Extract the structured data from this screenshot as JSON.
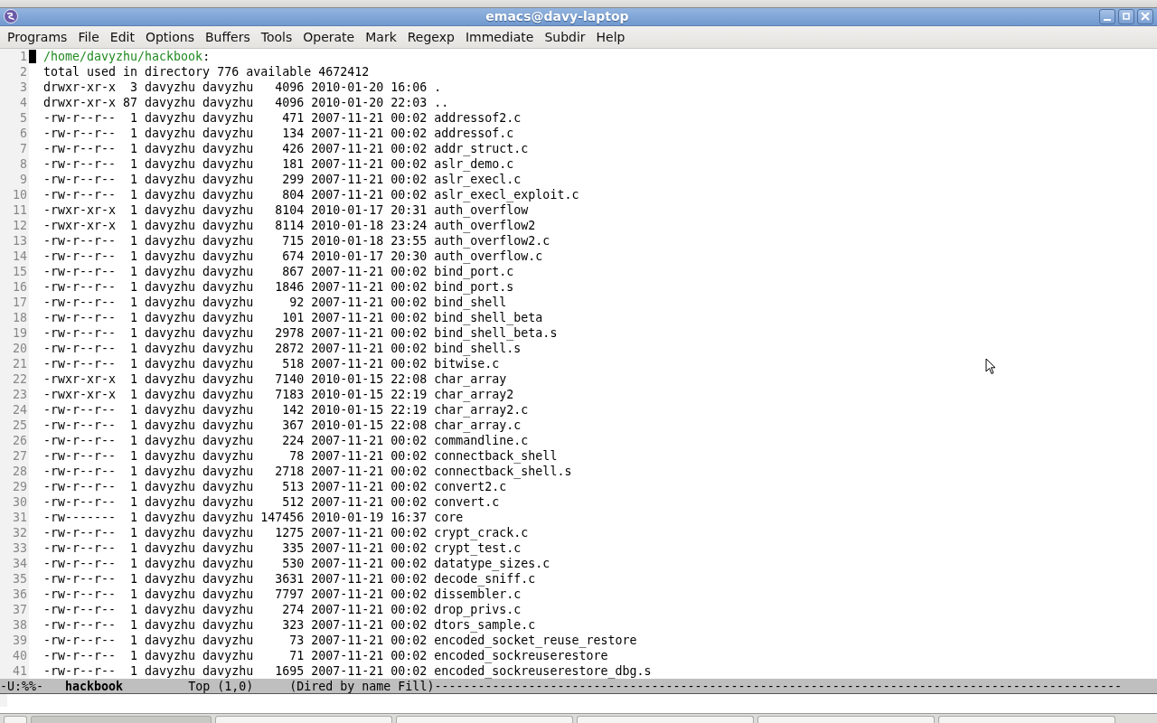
{
  "window": {
    "title": "emacs@davy-laptop"
  },
  "menu": [
    "Programs",
    "File",
    "Edit",
    "Options",
    "Buffers",
    "Tools",
    "Operate",
    "Mark",
    "Regexp",
    "Immediate",
    "Subdir",
    "Help"
  ],
  "buffer": {
    "lines": [
      {
        "kind": "header",
        "number": "1",
        "path": "/home/davyzhu/hackbook",
        "suffix": ":"
      },
      {
        "kind": "summary",
        "number": "2",
        "text": "total used in directory 776 available 4672412"
      },
      {
        "kind": "entry",
        "number": "3",
        "text": "drwxr-xr-x  3 davyzhu davyzhu   4096 2010-01-20 16:06 ."
      },
      {
        "kind": "entry",
        "number": "4",
        "text": "drwxr-xr-x 87 davyzhu davyzhu   4096 2010-01-20 22:03 .."
      },
      {
        "kind": "entry",
        "number": "5",
        "text": "-rw-r--r--  1 davyzhu davyzhu    471 2007-11-21 00:02 addressof2.c"
      },
      {
        "kind": "entry",
        "number": "6",
        "text": "-rw-r--r--  1 davyzhu davyzhu    134 2007-11-21 00:02 addressof.c"
      },
      {
        "kind": "entry",
        "number": "7",
        "text": "-rw-r--r--  1 davyzhu davyzhu    426 2007-11-21 00:02 addr_struct.c"
      },
      {
        "kind": "entry",
        "number": "8",
        "text": "-rw-r--r--  1 davyzhu davyzhu    181 2007-11-21 00:02 aslr_demo.c"
      },
      {
        "kind": "entry",
        "number": "9",
        "text": "-rw-r--r--  1 davyzhu davyzhu    299 2007-11-21 00:02 aslr_execl.c"
      },
      {
        "kind": "entry",
        "number": "10",
        "text": "-rw-r--r--  1 davyzhu davyzhu    804 2007-11-21 00:02 aslr_execl_exploit.c"
      },
      {
        "kind": "entry",
        "number": "11",
        "text": "-rwxr-xr-x  1 davyzhu davyzhu   8104 2010-01-17 20:31 auth_overflow"
      },
      {
        "kind": "entry",
        "number": "12",
        "text": "-rwxr-xr-x  1 davyzhu davyzhu   8114 2010-01-18 23:24 auth_overflow2"
      },
      {
        "kind": "entry",
        "number": "13",
        "text": "-rw-r--r--  1 davyzhu davyzhu    715 2010-01-18 23:55 auth_overflow2.c"
      },
      {
        "kind": "entry",
        "number": "14",
        "text": "-rw-r--r--  1 davyzhu davyzhu    674 2010-01-17 20:30 auth_overflow.c"
      },
      {
        "kind": "entry",
        "number": "15",
        "text": "-rw-r--r--  1 davyzhu davyzhu    867 2007-11-21 00:02 bind_port.c"
      },
      {
        "kind": "entry",
        "number": "16",
        "text": "-rw-r--r--  1 davyzhu davyzhu   1846 2007-11-21 00:02 bind_port.s"
      },
      {
        "kind": "entry",
        "number": "17",
        "text": "-rw-r--r--  1 davyzhu davyzhu     92 2007-11-21 00:02 bind_shell"
      },
      {
        "kind": "entry",
        "number": "18",
        "text": "-rw-r--r--  1 davyzhu davyzhu    101 2007-11-21 00:02 bind_shell_beta"
      },
      {
        "kind": "entry",
        "number": "19",
        "text": "-rw-r--r--  1 davyzhu davyzhu   2978 2007-11-21 00:02 bind_shell_beta.s"
      },
      {
        "kind": "entry",
        "number": "20",
        "text": "-rw-r--r--  1 davyzhu davyzhu   2872 2007-11-21 00:02 bind_shell.s"
      },
      {
        "kind": "entry",
        "number": "21",
        "text": "-rw-r--r--  1 davyzhu davyzhu    518 2007-11-21 00:02 bitwise.c"
      },
      {
        "kind": "entry",
        "number": "22",
        "text": "-rwxr-xr-x  1 davyzhu davyzhu   7140 2010-01-15 22:08 char_array"
      },
      {
        "kind": "entry",
        "number": "23",
        "text": "-rwxr-xr-x  1 davyzhu davyzhu   7183 2010-01-15 22:19 char_array2"
      },
      {
        "kind": "entry",
        "number": "24",
        "text": "-rw-r--r--  1 davyzhu davyzhu    142 2010-01-15 22:19 char_array2.c"
      },
      {
        "kind": "entry",
        "number": "25",
        "text": "-rw-r--r--  1 davyzhu davyzhu    367 2010-01-15 22:08 char_array.c"
      },
      {
        "kind": "entry",
        "number": "26",
        "text": "-rw-r--r--  1 davyzhu davyzhu    224 2007-11-21 00:02 commandline.c"
      },
      {
        "kind": "entry",
        "number": "27",
        "text": "-rw-r--r--  1 davyzhu davyzhu     78 2007-11-21 00:02 connectback_shell"
      },
      {
        "kind": "entry",
        "number": "28",
        "text": "-rw-r--r--  1 davyzhu davyzhu   2718 2007-11-21 00:02 connectback_shell.s"
      },
      {
        "kind": "entry",
        "number": "29",
        "text": "-rw-r--r--  1 davyzhu davyzhu    513 2007-11-21 00:02 convert2.c"
      },
      {
        "kind": "entry",
        "number": "30",
        "text": "-rw-r--r--  1 davyzhu davyzhu    512 2007-11-21 00:02 convert.c"
      },
      {
        "kind": "entry",
        "number": "31",
        "text": "-rw-------  1 davyzhu davyzhu 147456 2010-01-19 16:37 core"
      },
      {
        "kind": "entry",
        "number": "32",
        "text": "-rw-r--r--  1 davyzhu davyzhu   1275 2007-11-21 00:02 crypt_crack.c"
      },
      {
        "kind": "entry",
        "number": "33",
        "text": "-rw-r--r--  1 davyzhu davyzhu    335 2007-11-21 00:02 crypt_test.c"
      },
      {
        "kind": "entry",
        "number": "34",
        "text": "-rw-r--r--  1 davyzhu davyzhu    530 2007-11-21 00:02 datatype_sizes.c"
      },
      {
        "kind": "entry",
        "number": "35",
        "text": "-rw-r--r--  1 davyzhu davyzhu   3631 2007-11-21 00:02 decode_sniff.c"
      },
      {
        "kind": "entry",
        "number": "36",
        "text": "-rw-r--r--  1 davyzhu davyzhu   7797 2007-11-21 00:02 dissembler.c"
      },
      {
        "kind": "entry",
        "number": "37",
        "text": "-rw-r--r--  1 davyzhu davyzhu    274 2007-11-21 00:02 drop_privs.c"
      },
      {
        "kind": "entry",
        "number": "38",
        "text": "-rw-r--r--  1 davyzhu davyzhu    323 2007-11-21 00:02 dtors_sample.c"
      },
      {
        "kind": "entry",
        "number": "39",
        "text": "-rw-r--r--  1 davyzhu davyzhu     73 2007-11-21 00:02 encoded_socket_reuse_restore"
      },
      {
        "kind": "entry",
        "number": "40",
        "text": "-rw-r--r--  1 davyzhu davyzhu     71 2007-11-21 00:02 encoded_sockreuserestore"
      },
      {
        "kind": "entry",
        "number": "41",
        "text": "-rw-r--r--  1 davyzhu davyzhu   1695 2007-11-21 00:02 encoded_sockreuserestore_dbg.s"
      }
    ]
  },
  "mode_line": {
    "status": "-U:%%-",
    "buffer_name": "hackbook",
    "position": "Top (1,0)",
    "modes": "(Dired by name Fill)",
    "fill": "-----------------------------------------------------------------------------------------------"
  }
}
